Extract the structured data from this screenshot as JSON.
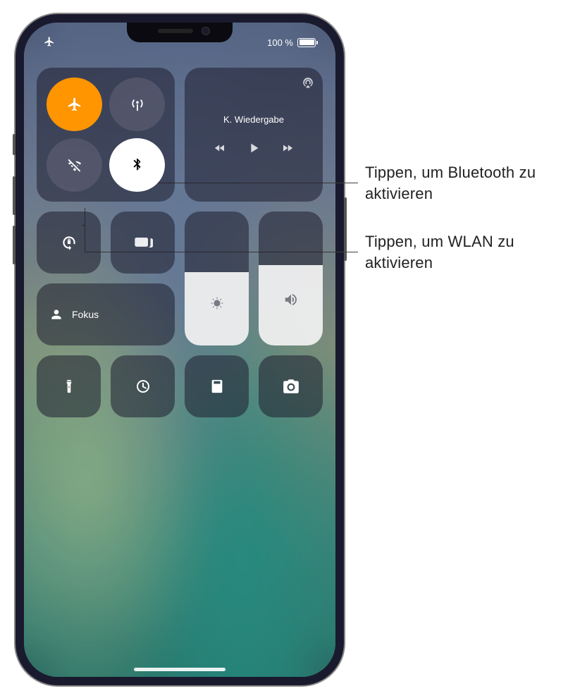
{
  "status_bar": {
    "battery_text": "100 %"
  },
  "media": {
    "now_playing": "K. Wiedergabe"
  },
  "focus": {
    "label": "Fokus"
  },
  "sliders": {
    "brightness_pct": 55,
    "volume_pct": 60
  },
  "icons": {
    "airplane": "airplane-icon",
    "cellular": "antenna-icon",
    "wifi_off": "wifi-off-icon",
    "bluetooth": "bluetooth-icon",
    "airplay": "airplay-icon",
    "rewind": "rewind-icon",
    "play": "play-icon",
    "forward": "forward-icon",
    "rotation_lock": "rotation-lock-icon",
    "screen_mirror": "screen-mirror-icon",
    "focus": "focus-person-icon",
    "brightness": "brightness-icon",
    "volume": "speaker-icon",
    "flashlight": "flashlight-icon",
    "timer": "timer-icon",
    "calculator": "calculator-icon",
    "camera": "camera-icon"
  },
  "callouts": {
    "bluetooth": "Tippen, um Bluetooth zu aktivieren",
    "wlan": "Tippen, um WLAN zu aktivieren"
  }
}
